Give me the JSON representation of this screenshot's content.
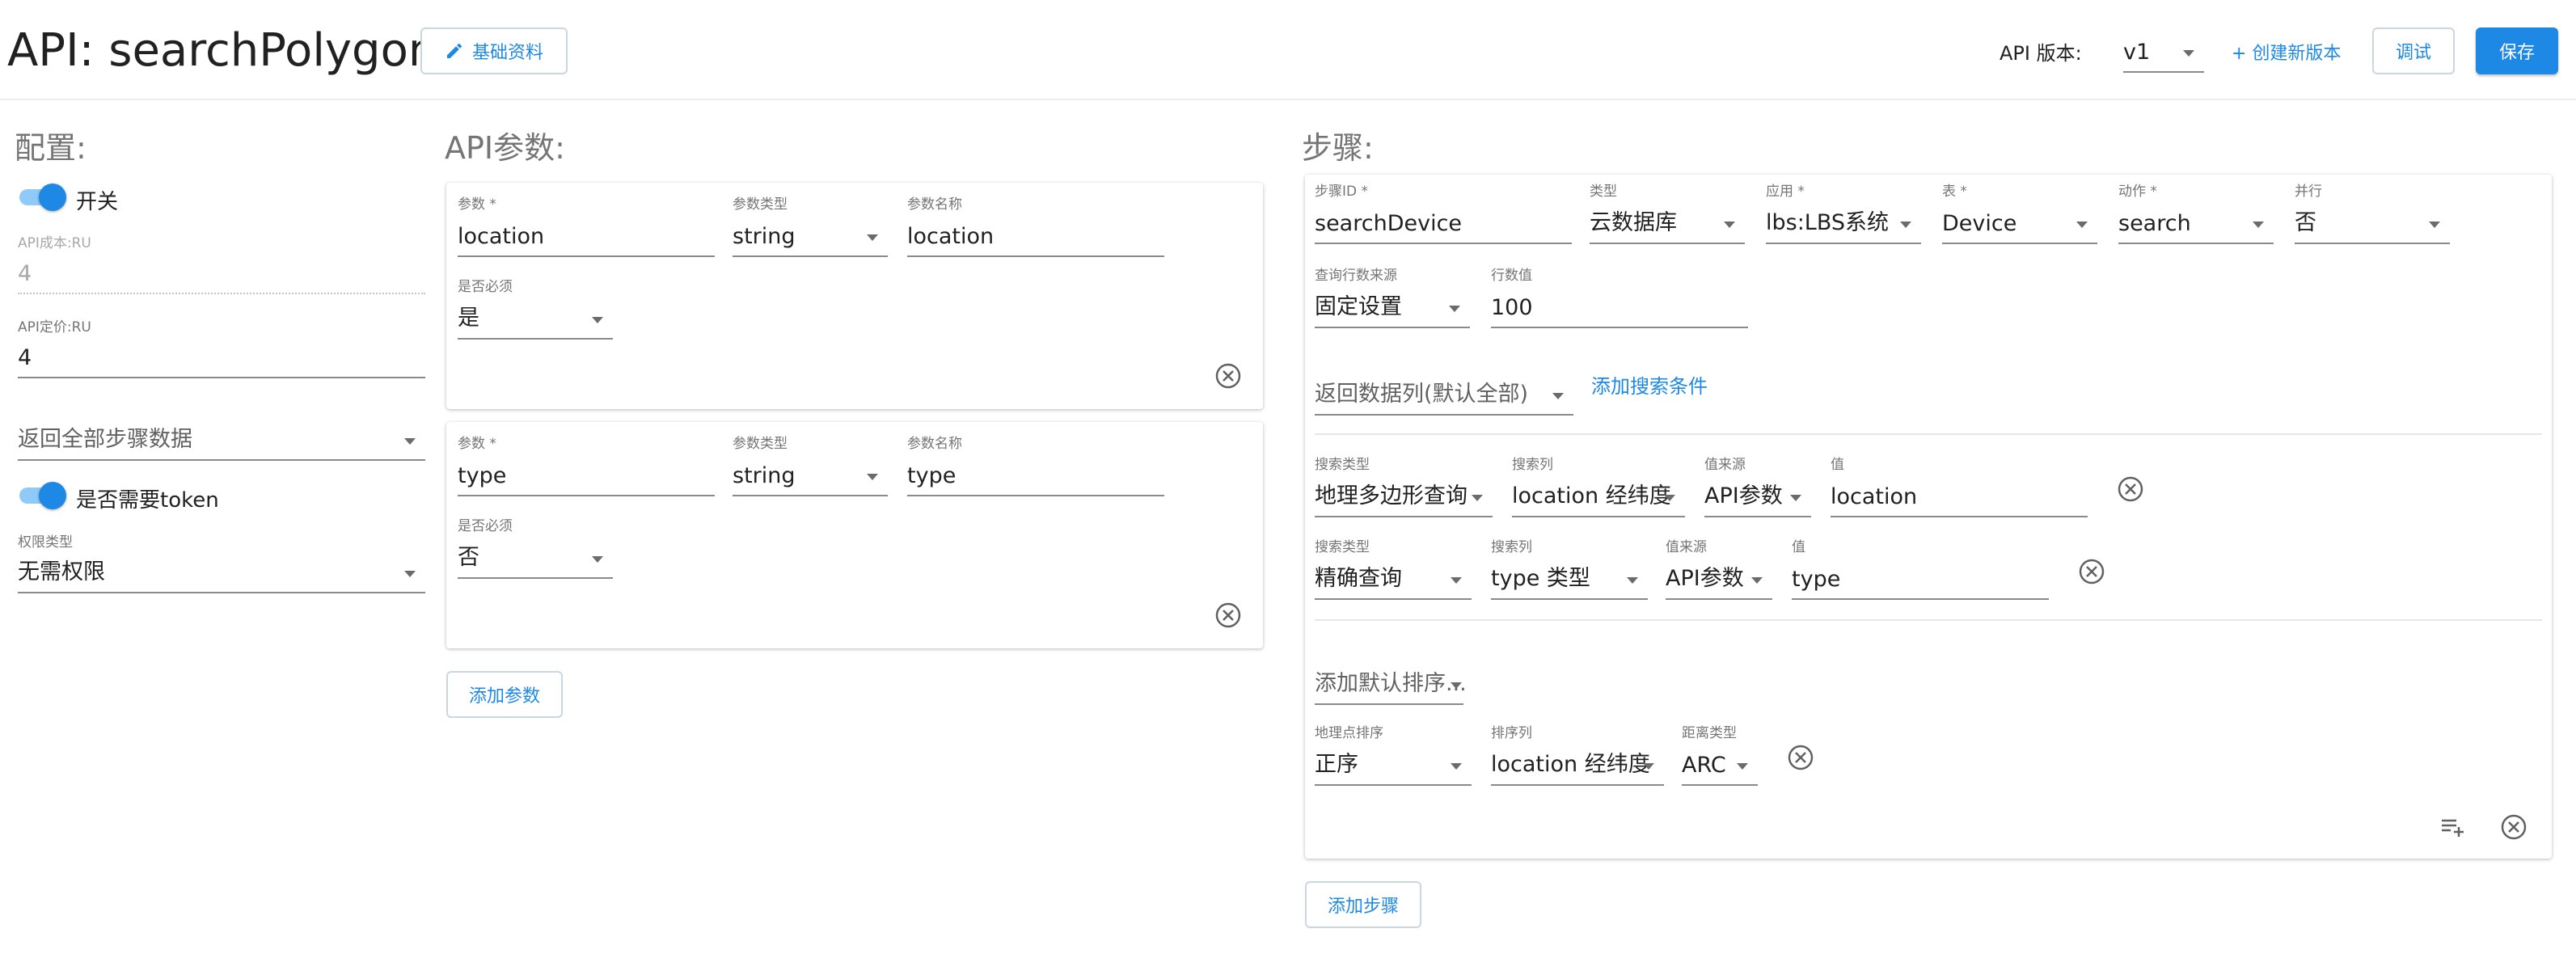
{
  "header": {
    "title": "API: searchPolygon",
    "basic_info_label": "基础资料",
    "version_label": "API 版本:",
    "version_value": "v1",
    "create_version_label": "+ 创建新版本",
    "debug_label": "调试",
    "save_label": "保存"
  },
  "config": {
    "title": "配置:",
    "switch_label": "开关",
    "cost_label": "API成本:RU",
    "cost_value": "4",
    "price_label": "API定价:RU",
    "price_value": "4",
    "return_mode": "返回全部步骤数据",
    "token_label": "是否需要token",
    "permission_label": "权限类型",
    "permission_value": "无需权限"
  },
  "params": {
    "title": "API参数:",
    "items": [
      {
        "param_label": "参数 *",
        "param_value": "location",
        "type_label": "参数类型",
        "type_value": "string",
        "name_label": "参数名称",
        "name_value": "location",
        "required_label": "是否必须",
        "required_value": "是"
      },
      {
        "param_label": "参数 *",
        "param_value": "type",
        "type_label": "参数类型",
        "type_value": "string",
        "name_label": "参数名称",
        "name_value": "type",
        "required_label": "是否必须",
        "required_value": "否"
      }
    ],
    "add_label": "添加参数"
  },
  "steps": {
    "title": "步骤:",
    "step": {
      "id_label": "步骤ID *",
      "id_value": "searchDevice",
      "kind_label": "类型",
      "kind_value": "云数据库",
      "app_label": "应用 *",
      "app_value": "lbs:LBS系统",
      "table_label": "表 *",
      "table_value": "Device",
      "action_label": "动作 *",
      "action_value": "search",
      "parallel_label": "并行",
      "parallel_value": "否",
      "rows_src_label": "查询行数来源",
      "rows_src_value": "固定设置",
      "rows_label": "行数值",
      "rows_value": "100",
      "return_cols": "返回数据列(默认全部)",
      "add_cond_label": "添加搜索条件",
      "conditions": [
        {
          "kind_label": "搜索类型",
          "kind_value": "地理多边形查询",
          "col_label": "搜索列",
          "col_value": "location 经纬度",
          "src_label": "值来源",
          "src_value": "API参数",
          "val_label": "值",
          "val_value": "location"
        },
        {
          "kind_label": "搜索类型",
          "kind_value": "精确查询",
          "col_label": "搜索列",
          "col_value": "type 类型",
          "src_label": "值来源",
          "src_value": "API参数",
          "val_label": "值",
          "val_value": "type"
        }
      ],
      "add_sort": "添加默认排序...",
      "sort": {
        "order_label": "地理点排序",
        "order_value": "正序",
        "col_label": "排序列",
        "col_value": "location 经纬度",
        "dist_label": "距离类型",
        "dist_value": "ARC"
      }
    },
    "add_label": "添加步骤"
  },
  "colors": {
    "accent": "#1e88e5",
    "track": "#90caf9"
  }
}
